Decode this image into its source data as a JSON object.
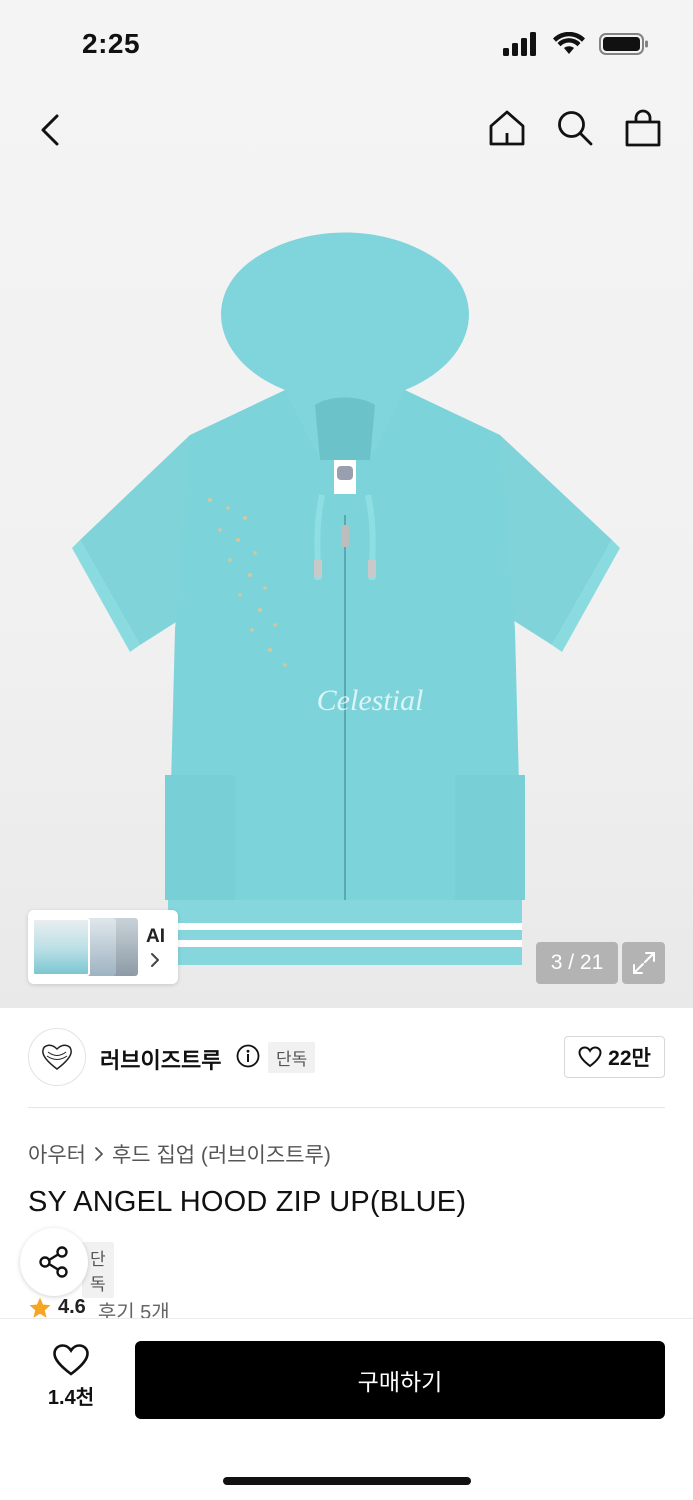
{
  "status_bar": {
    "time": "2:25"
  },
  "icons": {
    "back": "chevron-left-icon",
    "home": "home-icon",
    "search": "search-icon",
    "cart": "shopping-bag-icon",
    "expand": "expand-icon",
    "info": "info-icon",
    "heart": "heart-icon",
    "share": "share-icon",
    "star": "star-icon"
  },
  "gallery": {
    "counter": "3 / 21",
    "ai_label": "AI",
    "image_overlay_text": "Celestial",
    "garment_color": "#7dd3da"
  },
  "brand": {
    "name": "러브이즈트루",
    "tag": "단독",
    "likes": "22만"
  },
  "breadcrumb": {
    "category": "아우터",
    "subcategory": "후드 집업 (러브이즈트루)"
  },
  "product": {
    "title": "SY ANGEL HOOD ZIP UP(BLUE)",
    "exclusive_tag": "단독",
    "rating": "4.6",
    "review_text": "후기 5개"
  },
  "bottom_bar": {
    "wish_count": "1.4천",
    "buy_label": "구매하기"
  },
  "colors": {
    "accent_black": "#000000",
    "star": "#f5a623",
    "tag_bg": "#f1f1f1"
  }
}
